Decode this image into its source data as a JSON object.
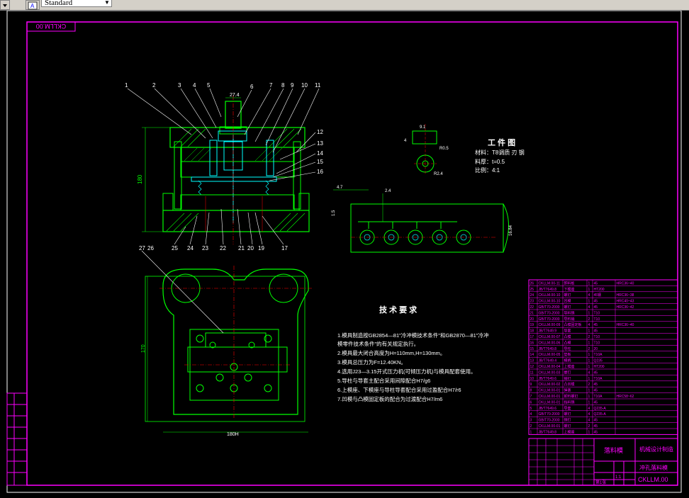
{
  "toolbar": {
    "text_style": "Standard",
    "icons": [
      "dropdown-arrow-icon",
      "text-style-icon"
    ]
  },
  "drawing": {
    "sheet_code": "CKLLM.00",
    "sheet_code_mirrored": "CKLLM.00",
    "dims": {
      "top_width": "27.4",
      "height_left": "180",
      "plan_width": "180H",
      "plan_height": "170",
      "part_a": "9.1",
      "part_b": "R0.5",
      "part_c": "R2.4",
      "part_d": "4",
      "strip_a": "4.7",
      "strip_b": "2.4",
      "strip_c": "1.5",
      "strip_d": "16.84"
    },
    "workpiece": {
      "title": "工 件 图",
      "line1": "材料：T8调质 刃 钢",
      "line2": "料厚：t=0.5",
      "line3": "比例：4:1"
    },
    "requirements": {
      "title": "技 术 要 求",
      "items": [
        "1.模具制造按GB2854—81\"冷冲模技术条件\"和GB2870—81\"冷冲",
        "模零件技术条件\"的有关规定执行。",
        "2.模具最大闭合高度为H=110mm,H=130mm。",
        "3.模具总压力为F=12.40KN。",
        "4.选用J23—3.15开式压力机(可倾压力机)与模具配套使用。",
        "5.导柱与导套主配合采用间隙配合H7/g6",
        "6.上模座、下模座与导柱导套配合采用过盈配合H7/r6",
        "7.凹模与凸模固定板的配合为过渡配合H7/m6"
      ]
    },
    "title_block": {
      "part_name": "落料模",
      "school": "机械设计制造",
      "drawing_name": "冲孔落料模",
      "code": "CKLLM.00",
      "scale": "1:1",
      "sheet": "第1张"
    },
    "callouts_top": [
      "1",
      "2",
      "3",
      "4",
      "5",
      "6",
      "7",
      "8",
      "9",
      "10",
      "11"
    ],
    "callouts_right": [
      "12",
      "13",
      "14",
      "15",
      "16"
    ],
    "callouts_bottom": [
      "25",
      "24",
      "23",
      "22",
      "21",
      "20",
      "19",
      "17"
    ],
    "callout_26": "26",
    "callout_27": "27"
  },
  "bom": [
    [
      "26",
      "CKLLM.00-11",
      "卸料板",
      "1",
      "45",
      "HRC36~40"
    ],
    [
      "25",
      "JB/T7649.8",
      "下模座",
      "1",
      "HT200",
      ""
    ],
    [
      "24",
      "CKLLM.00-10",
      "螺钉",
      "4",
      "45钢",
      "HRC36~38"
    ],
    [
      "23",
      "CKLLM.00-10",
      "凹模",
      "1",
      "45",
      "HRC40~43"
    ],
    [
      "22",
      "GB/T70-2000",
      "螺钉",
      "4",
      "45",
      "HRC36~42"
    ],
    [
      "21",
      "GB/T70-2000",
      "导料销",
      "1",
      "T10",
      ""
    ],
    [
      "20",
      "GB/T70-2000",
      "导料销",
      "2",
      "T10",
      ""
    ],
    [
      "19",
      "CKLLM.00-09",
      "凸模固定板",
      "4",
      "45",
      "HRC36~40"
    ],
    [
      "18",
      "JB/T7649.9",
      "导套",
      "1",
      "45",
      ""
    ],
    [
      "17",
      "CKLLM.00-07",
      "凸模",
      "2",
      "T10",
      ""
    ],
    [
      "16",
      "CKLLM.00-06",
      "凸模",
      "1",
      "T10",
      ""
    ],
    [
      "15",
      "JB/T7649.8",
      "导柱",
      "2",
      "20",
      ""
    ],
    [
      "14",
      "CKLLM.00-05",
      "垫板",
      "1",
      "T10A",
      ""
    ],
    [
      "13",
      "JB/T7649.4",
      "模柄",
      "1",
      "Q235",
      ""
    ],
    [
      "12",
      "CKLLM.00-04",
      "上模座",
      "1",
      "HT200",
      ""
    ],
    [
      "11",
      "CKLLM.00-03",
      "螺钉",
      "4",
      "45",
      ""
    ],
    [
      "10",
      "JB/T7649.6",
      "销钉",
      "1",
      "T10A",
      ""
    ],
    [
      "9",
      "CKLLM.00-02",
      "凸凹模",
      "2",
      "45",
      ""
    ],
    [
      "8",
      "CKLLM.00-01",
      "弹簧",
      "1",
      "45",
      ""
    ],
    [
      "7",
      "CKLLM.00-01",
      "卸料螺钉",
      "1",
      "T10A",
      "HRC58~62"
    ],
    [
      "6",
      "CKLLM.00-01",
      "挡料销",
      "1",
      "45",
      ""
    ],
    [
      "5",
      "JB/T7649.6",
      "导套",
      "4",
      "Q235-A",
      ""
    ],
    [
      "4",
      "GB/T70-2000",
      "螺钉",
      "4",
      "Q235-A",
      ""
    ],
    [
      "3",
      "GB/T70-2000",
      "销钉",
      "4",
      "45",
      ""
    ],
    [
      "2",
      "CKLLM.00-01",
      "螺钉",
      "2",
      "45",
      ""
    ],
    [
      "1",
      "JB/T7649.8",
      "上模座",
      "1",
      "45",
      ""
    ]
  ]
}
